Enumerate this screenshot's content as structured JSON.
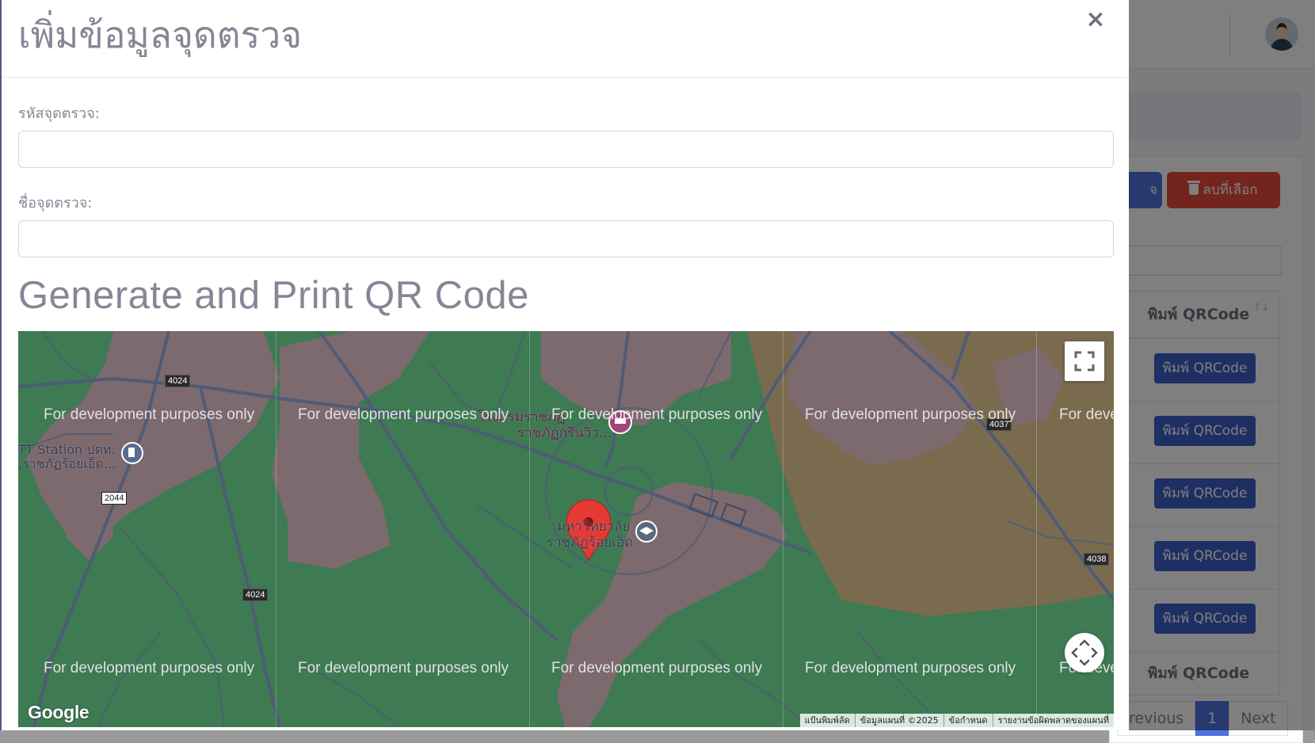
{
  "background": {
    "delete_selected_label": "ลบที่เลือก",
    "partial_button_label": "จ",
    "table_header": "พิมพ์ QRCode",
    "sort_icon": "↑↓",
    "rows": [
      {
        "print_label": "พิมพ์ QRCode"
      },
      {
        "print_label": "พิมพ์ QRCode"
      },
      {
        "print_label": "พิมพ์ QRCode"
      },
      {
        "print_label": "พิมพ์ QRCode"
      },
      {
        "print_label": "พิมพ์ QRCode"
      }
    ],
    "table_footer": "พิมพ์ QRCode",
    "pagination": {
      "previous": "revious",
      "page": "1",
      "next": "Next"
    }
  },
  "modal": {
    "title": "เพิ่มข้อมูลจุดตรวจ",
    "close_symbol": "×",
    "code_label": "รหัสจุดตรวจ:",
    "code_value": "",
    "name_label": "ชื่อจุดตรวจ:",
    "name_value": "",
    "qr_heading": "Generate and Print QR Code"
  },
  "map": {
    "watermark": "For development purposes only",
    "watermark_partial": "For deve",
    "labels": {
      "gas_station": "TT Station ปตท.",
      "gas_station_sub": ",ราชภัฏร้อยเอ็ด...",
      "hotel_line1": "โรงแรมราชภัฏ",
      "hotel_line2": "ราชภัฏกรีนวิว...",
      "university_line1": "มหาวิทยาลัย",
      "university_line2": "ราชภัฏร้อยเอ็ด"
    },
    "road_numbers": [
      "4024",
      "2044",
      "4024",
      "4037",
      "4038"
    ],
    "google_logo": "Google",
    "attribution": [
      "แป้นพิมพ์ลัด",
      "ข้อมูลแผนที่ ©2025",
      "ข้อกำหนด",
      "รายงานข้อผิดพลาดของแผนที่"
    ],
    "colors": {
      "green": "#3e7a52",
      "urban": "#7c6a6e",
      "brown": "#7a6b4e",
      "road": "#4f5b78"
    }
  }
}
